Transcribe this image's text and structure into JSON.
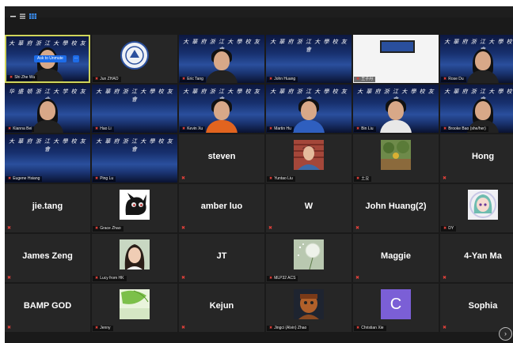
{
  "toolbar": {
    "icons": [
      "minimize-icon",
      "menu-icon",
      "gallery-view-icon"
    ]
  },
  "banner_text": "大 華 府 浙 江 大 學 校 友 會",
  "banner_text_alt": "华 盛 顿 浙 江 大 学 校 友 会",
  "ask_to_unmute": "Ask to Unmute",
  "more_dots": "···",
  "next_page": "›",
  "colors": {
    "active_border": "#cfd45a",
    "mute_icon": "#e0403a",
    "unmute_button": "#1d6ce8"
  },
  "participants": [
    {
      "name": "Shi Zhe Wu",
      "type": "banner-person",
      "active": true
    },
    {
      "name": "Jun ZHAO",
      "type": "logo"
    },
    {
      "name": "Eric Tang",
      "type": "banner-person"
    },
    {
      "name": "John Huang",
      "type": "banner"
    },
    {
      "name": "王子丹",
      "type": "whiteboard"
    },
    {
      "name": "Rose Du",
      "type": "banner-person"
    },
    {
      "name": "Kianna Bei",
      "type": "banner-person"
    },
    {
      "name": "Hao Li",
      "type": "banner"
    },
    {
      "name": "Kevin Xu",
      "type": "banner-person"
    },
    {
      "name": "Martin Hu",
      "type": "banner-person"
    },
    {
      "name": "Bin Liu",
      "type": "banner-person"
    },
    {
      "name": "Brooke Bao (she/her)",
      "type": "banner-person"
    },
    {
      "name": "Eugene Hsiang",
      "type": "banner"
    },
    {
      "name": "Ping Lu",
      "type": "banner"
    },
    {
      "name": "steven",
      "type": "text"
    },
    {
      "name": "Yuntao Liu",
      "type": "avatar-photo"
    },
    {
      "name": "土豆",
      "type": "avatar-garden"
    },
    {
      "name": "Hong",
      "type": "text"
    },
    {
      "name": "jie.tang",
      "type": "text"
    },
    {
      "name": "Grace Zhao",
      "type": "avatar-cat"
    },
    {
      "name": "amber luo",
      "type": "text"
    },
    {
      "name": "W",
      "type": "text"
    },
    {
      "name": "John Huang(2)",
      "type": "text"
    },
    {
      "name": "DY",
      "type": "avatar-anime"
    },
    {
      "name": "James Zeng",
      "type": "text"
    },
    {
      "name": "Lucy from HK",
      "type": "avatar-girl"
    },
    {
      "name": "JT",
      "type": "text"
    },
    {
      "name": "MLP32 ACS",
      "type": "avatar-dandelion"
    },
    {
      "name": "Maggie",
      "type": "text"
    },
    {
      "name": "4-Yan Ma",
      "type": "text"
    },
    {
      "name": "BAMP GOD",
      "type": "text"
    },
    {
      "name": "Jenny",
      "type": "avatar-leaf"
    },
    {
      "name": "Kejun",
      "type": "text"
    },
    {
      "name": "Jingci (Alvin) Zhao",
      "type": "avatar-warrior"
    },
    {
      "name": "Christian Xie",
      "type": "avatar-letter",
      "letter": "C"
    },
    {
      "name": "Sophia",
      "type": "text"
    }
  ]
}
